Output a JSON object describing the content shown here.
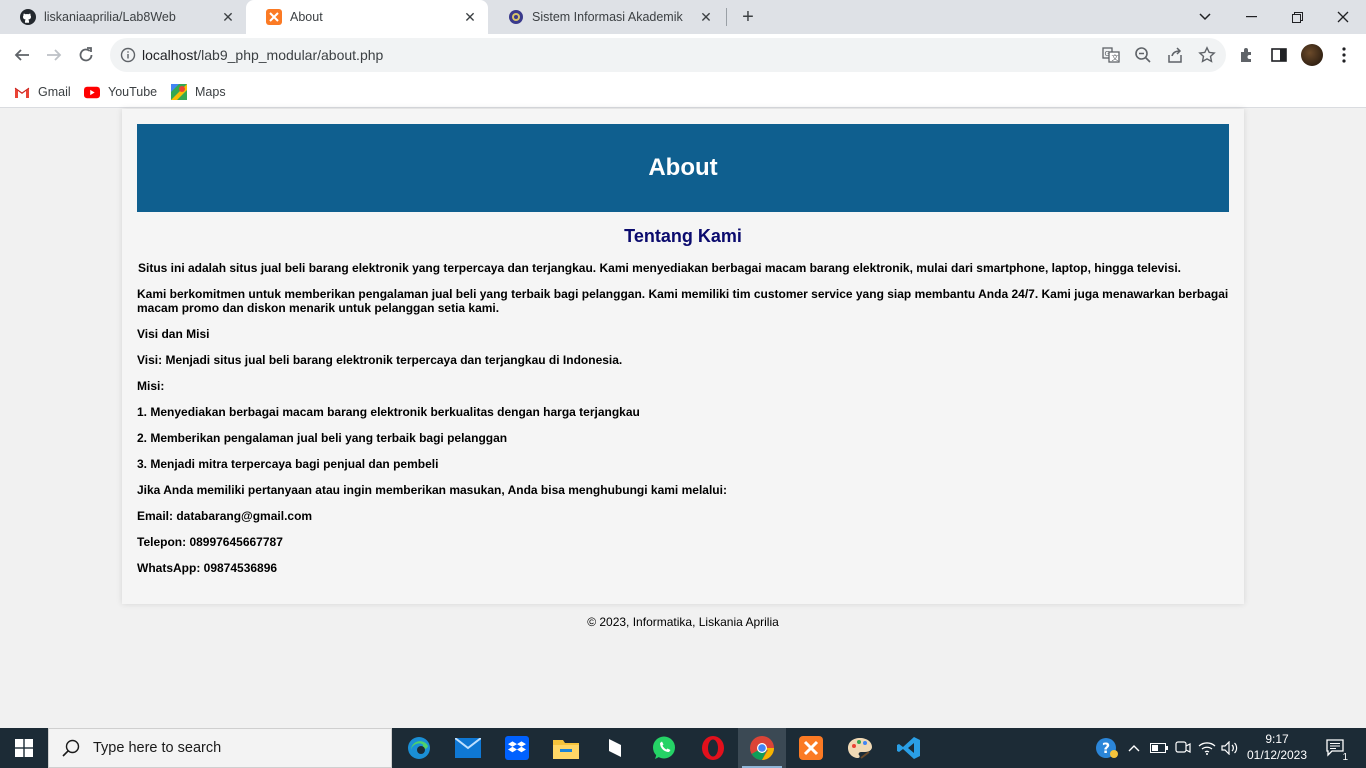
{
  "browser": {
    "tabs": [
      {
        "title": "liskaniaaprilia/Lab8Web",
        "icon": "github-icon"
      },
      {
        "title": "About",
        "icon": "xampp-icon",
        "active": true
      },
      {
        "title": "Sistem Informasi Akademik",
        "icon": "university-icon"
      }
    ],
    "url_host": "localhost",
    "url_path": "/lab9_php_modular/about.php",
    "bookmarks": [
      {
        "label": "Gmail",
        "icon": "gmail-icon"
      },
      {
        "label": "YouTube",
        "icon": "youtube-icon"
      },
      {
        "label": "Maps",
        "icon": "maps-icon"
      }
    ]
  },
  "page": {
    "header_title": "About",
    "section_title": "Tentang Kami",
    "paragraphs": [
      "Situs ini adalah situs jual beli barang elektronik yang terpercaya dan terjangkau. Kami menyediakan berbagai macam barang elektronik, mulai dari smartphone, laptop, hingga televisi.",
      "Kami berkomitmen untuk memberikan pengalaman jual beli yang terbaik bagi pelanggan. Kami memiliki tim customer service yang siap membantu Anda 24/7. Kami juga menawarkan berbagai macam promo dan diskon menarik untuk pelanggan setia kami.",
      "Visi dan Misi",
      "Visi: Menjadi situs jual beli barang elektronik terpercaya dan terjangkau di Indonesia.",
      "Misi:",
      "1. Menyediakan berbagai macam barang elektronik berkualitas dengan harga terjangkau",
      "2. Memberikan pengalaman jual beli yang terbaik bagi pelanggan",
      "3. Menjadi mitra terpercaya bagi penjual dan pembeli",
      "Jika Anda memiliki pertanyaan atau ingin memberikan masukan, Anda bisa menghubungi kami melalui:",
      "Email: databarang@gmail.com",
      "Telepon: 08997645667787",
      "WhatsApp: 09874536896"
    ],
    "footer": "© 2023, Informatika, Liskania Aprilia"
  },
  "taskbar": {
    "search_placeholder": "Type here to search",
    "time": "9:17",
    "date": "01/12/2023",
    "notification_count": "1",
    "apps": [
      "edge-icon",
      "mail-icon",
      "dropbox-icon",
      "file-explorer-icon",
      "sublime-icon",
      "whatsapp-icon",
      "opera-icon",
      "chrome-icon",
      "xampp-icon",
      "paint-icon",
      "vscode-icon"
    ]
  },
  "colors": {
    "header_bg": "#0f5f8f",
    "section_title": "#0b0b6e",
    "taskbar_bg": "#1c2b36"
  }
}
